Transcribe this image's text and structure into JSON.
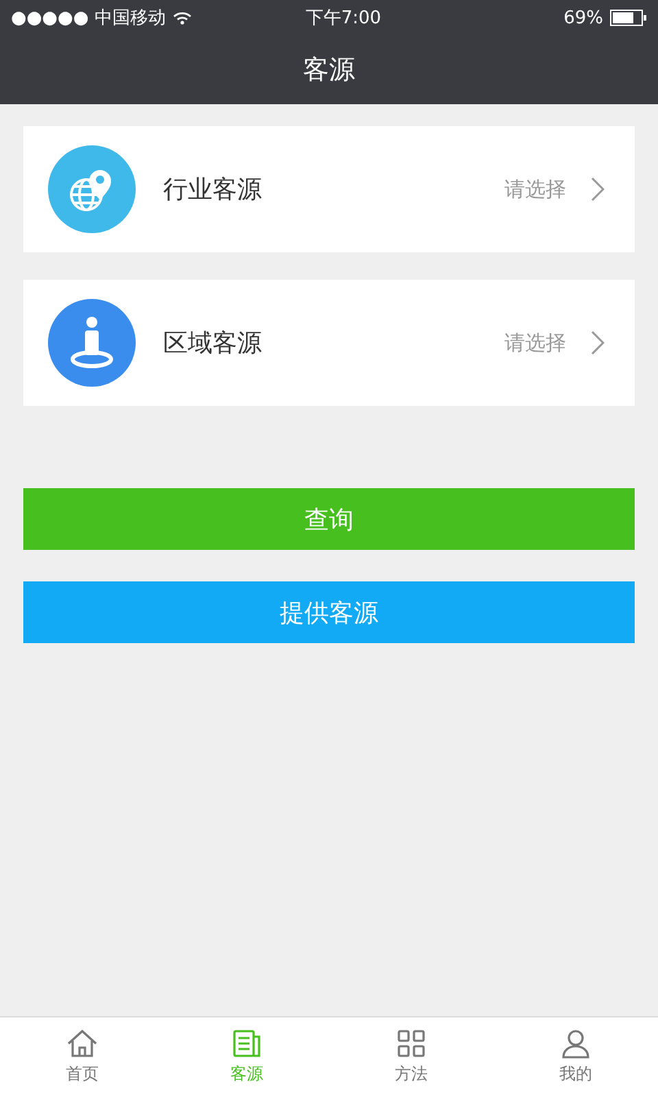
{
  "status_bar": {
    "carrier": "●●●●● 中国移动",
    "time": "下午7:00",
    "battery": "69%"
  },
  "nav": {
    "title": "客源"
  },
  "options": [
    {
      "kind": "globe",
      "label": "行业客源",
      "value": "请选择"
    },
    {
      "kind": "person",
      "label": "区域客源",
      "value": "请选择"
    }
  ],
  "buttons": [
    {
      "kind": "primary",
      "label": "查询"
    },
    {
      "kind": "secondary",
      "label": "提供客源"
    }
  ],
  "tabs": [
    {
      "kind": "home",
      "label": "首页",
      "selected": false
    },
    {
      "kind": "list",
      "label": "客源",
      "selected": true
    },
    {
      "kind": "grid",
      "label": "方法",
      "selected": false
    },
    {
      "kind": "user",
      "label": "我的",
      "selected": false
    }
  ]
}
